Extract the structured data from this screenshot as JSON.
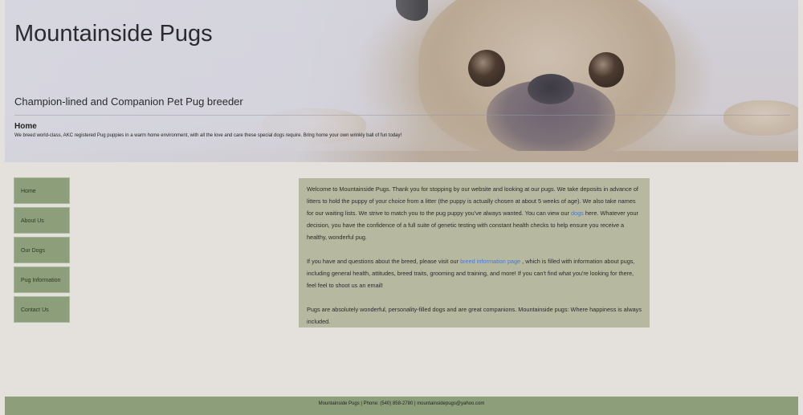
{
  "site": {
    "title": "Mountainside Pugs",
    "tagline": "Champion-lined and Companion Pet Pug breeder",
    "page_heading": "Home",
    "hero_description": "We breed world-class, AKC registered Pug puppies in a warm home environment, with all the love and care these special dogs require. Bring home your own wrinkly ball of fun today!"
  },
  "nav": {
    "items": [
      {
        "label": "Home"
      },
      {
        "label": "About Us"
      },
      {
        "label": "Our Dogs"
      },
      {
        "label": "Pug Information"
      },
      {
        "label": "Contact Us"
      }
    ]
  },
  "content": {
    "p1_a": "Welcome to Mountainside Pugs. Thank you for stopping by our website and looking at our pugs. We take deposits in advance of litters to hold the puppy of your choice from a litter (the puppy is actually chosen at about 5 weeks of age). We also take names for our waiting lists. We strive to match you to the pug puppy you've always wanted. You can view our ",
    "p1_link": "dogs",
    "p1_b": " here. Whatever your decision, you have the confidence of a full suite of genetic testing with constant health checks to help ensure you receive a healthy, wonderful pug.",
    "p2_a": "If you have and questions about the breed, please visit our ",
    "p2_link": "breed information page",
    "p2_b": " , which is filled with information about pugs, including general health, attitudes, breed traits, grooming and training, and more! If you can't find what you're looking for there, feel feel to shoot us an email!",
    "p3": "Pugs are absolutely wonderful, personality-filled dogs and are great companions. Mountainside pugs: Where happiness is always included."
  },
  "footer": {
    "text": "Mountainside Pugs | Phone: (540) 858-2780 | mountainsidepugs@yahoo.com"
  },
  "colors": {
    "page_bg": "#e4e1dc",
    "nav_bg": "#8d9e7b",
    "content_bg": "#b6b9a0",
    "footer_bg": "#8d9e7b",
    "link": "#4d77c9"
  },
  "icons": [
    "pug-hero-image"
  ]
}
